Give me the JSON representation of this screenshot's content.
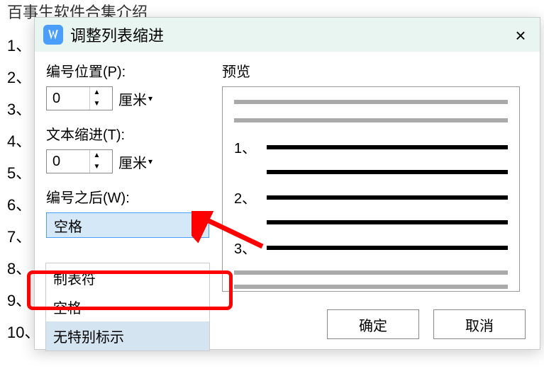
{
  "background": {
    "title": "百事生软件合集介绍",
    "list": [
      "1、",
      "2、",
      "3、",
      "4、",
      "5、",
      "6、",
      "7、",
      "8、",
      "9、",
      "10、"
    ]
  },
  "dialog": {
    "title": "调整列表缩进",
    "close_icon": "×",
    "number_pos_label": "编号位置(P):",
    "number_pos_value": "0",
    "number_pos_unit": "厘米",
    "text_indent_label": "文本缩进(T):",
    "text_indent_value": "0",
    "text_indent_unit": "厘米",
    "after_number_label": "编号之后(W):",
    "after_number_value": "空格",
    "dropdown_options": [
      "制表符",
      "空格",
      "无特别标示"
    ],
    "preview_label": "预览",
    "preview_numbers": [
      "1、",
      "2、",
      "3、"
    ],
    "ok_label": "确定",
    "cancel_label": "取消"
  }
}
